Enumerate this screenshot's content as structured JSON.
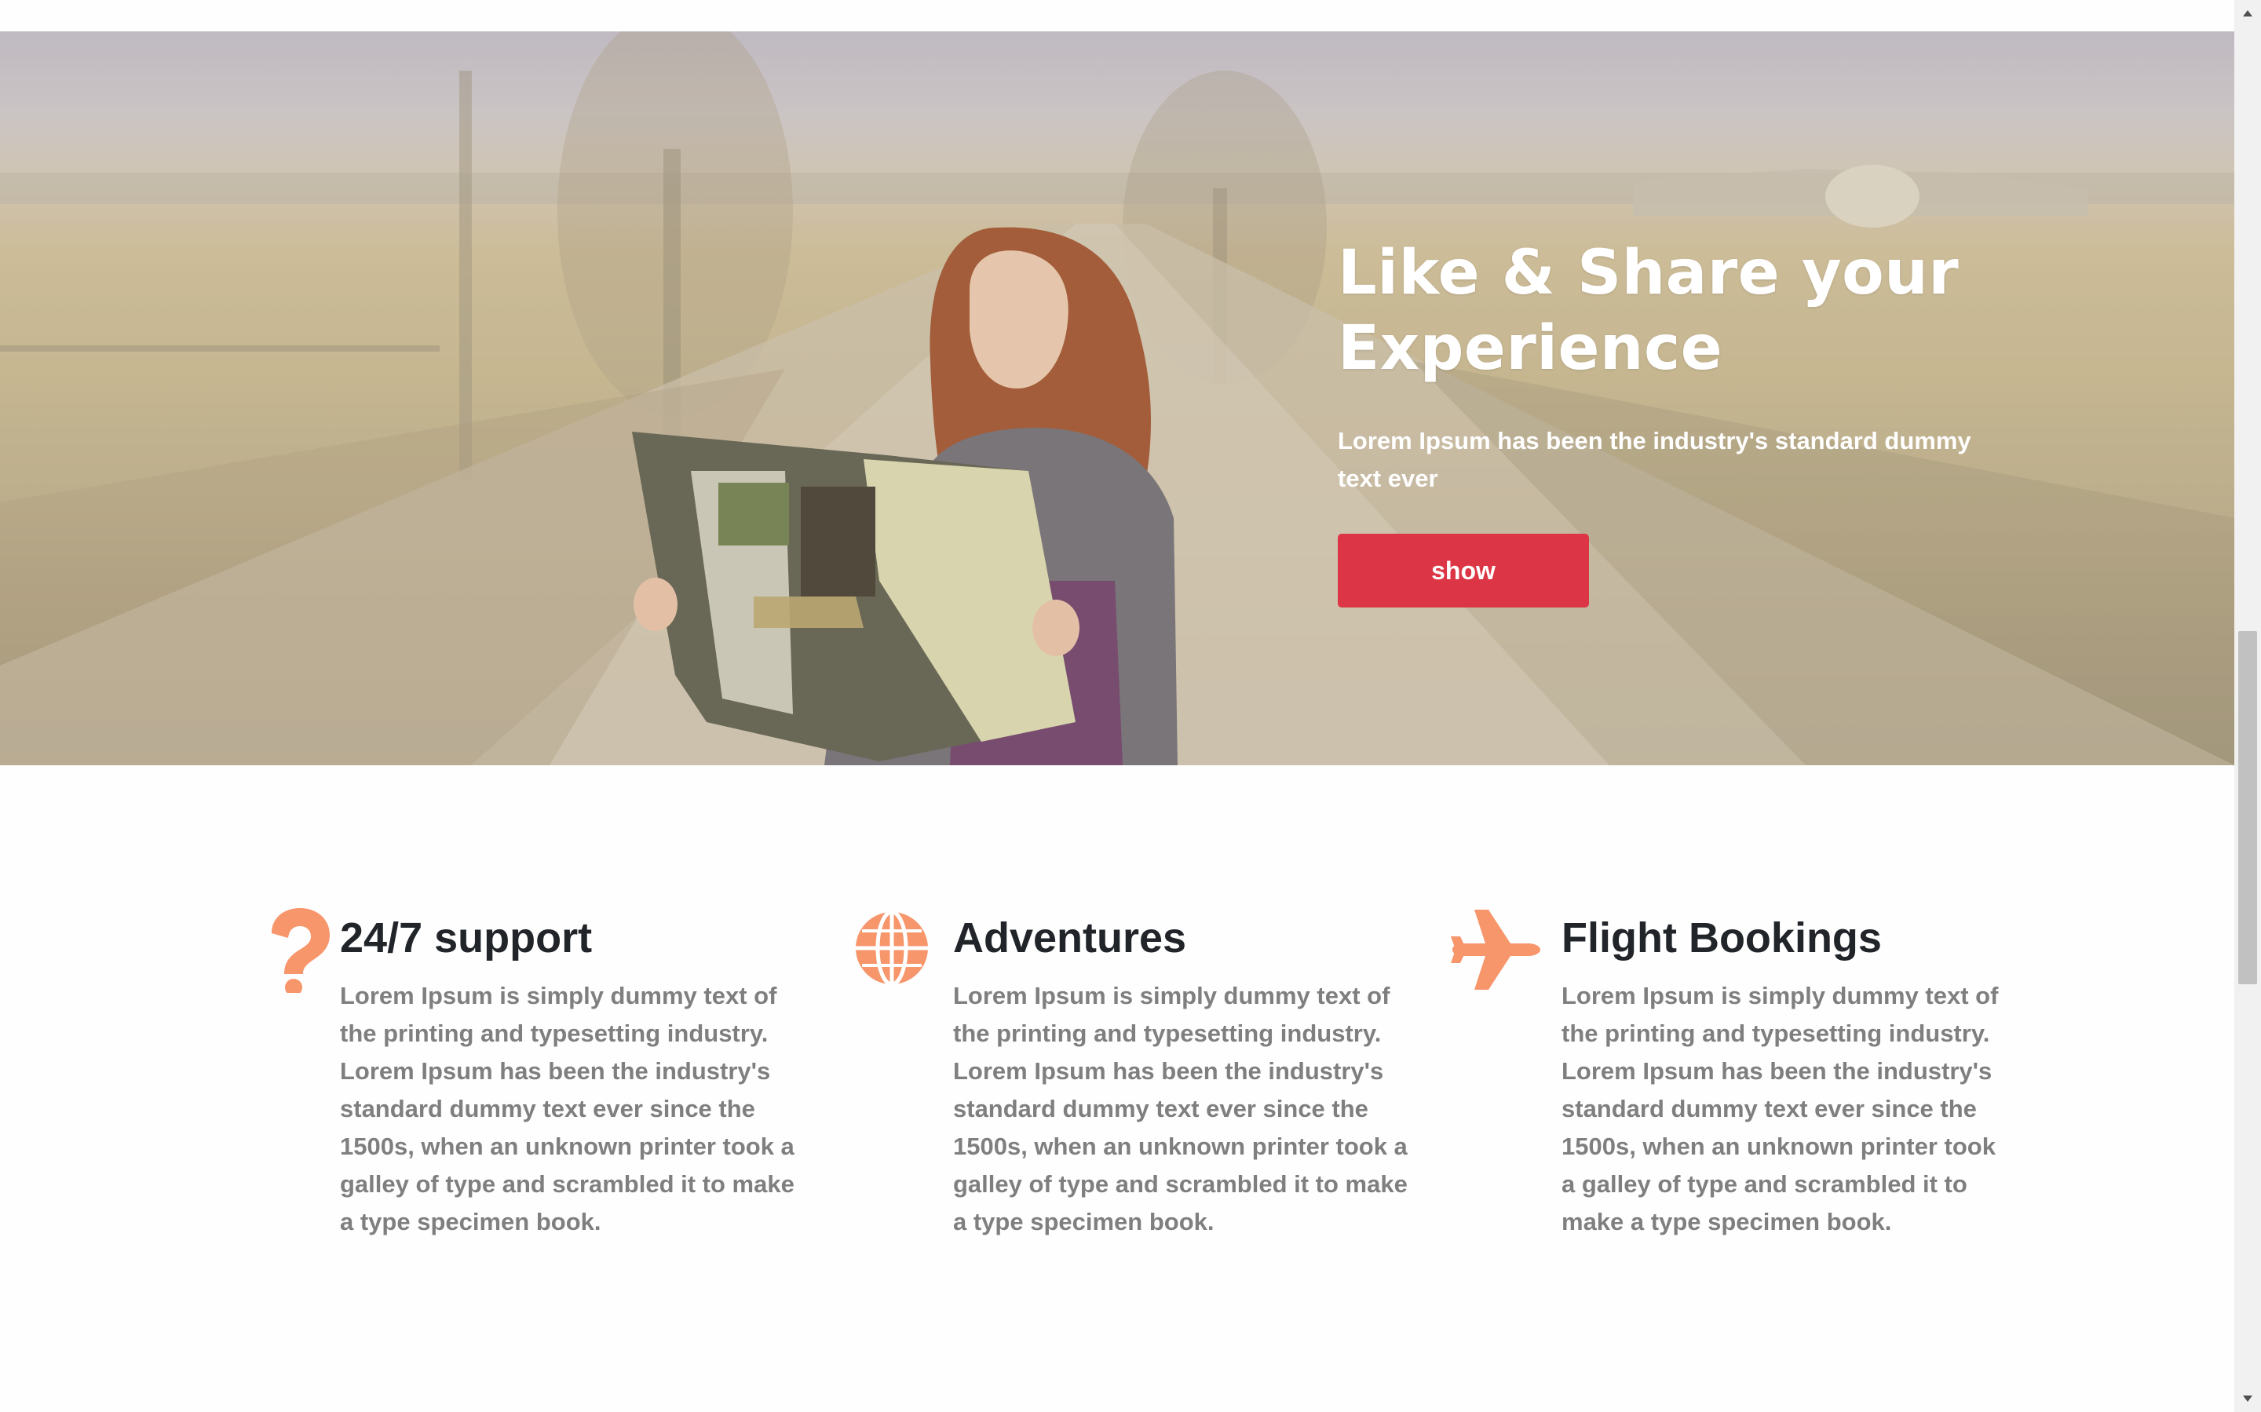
{
  "hero": {
    "title": "Like & Share your Experience",
    "text": "Lorem Ipsum has been the industry's standard dummy text ever",
    "button_label": "show",
    "button_color": "#dc3545"
  },
  "features": [
    {
      "icon": "question-icon",
      "title": "24/7 support",
      "text": "Lorem Ipsum is simply dummy text of the printing and typesetting industry. Lorem Ipsum has been the industry's standard dummy text ever since the 1500s, when an unknown printer took a galley of type and scrambled it to make a type specimen book."
    },
    {
      "icon": "globe-icon",
      "title": "Adventures",
      "text": "Lorem Ipsum is simply dummy text of the printing and typesetting industry. Lorem Ipsum has been the industry's standard dummy text ever since the 1500s, when an unknown printer took a galley of type and scrambled it to make a type specimen book."
    },
    {
      "icon": "plane-icon",
      "title": "Flight Bookings",
      "text": "Lorem Ipsum is simply dummy text of the printing and typesetting industry. Lorem Ipsum has been the industry's standard dummy text ever since the 1500s, when an unknown printer took a galley of type and scrambled it to make a type specimen book."
    }
  ],
  "colors": {
    "accent": "#f7956b",
    "button": "#dc3545",
    "heading": "#212529",
    "body_text": "#7f7f7f"
  }
}
